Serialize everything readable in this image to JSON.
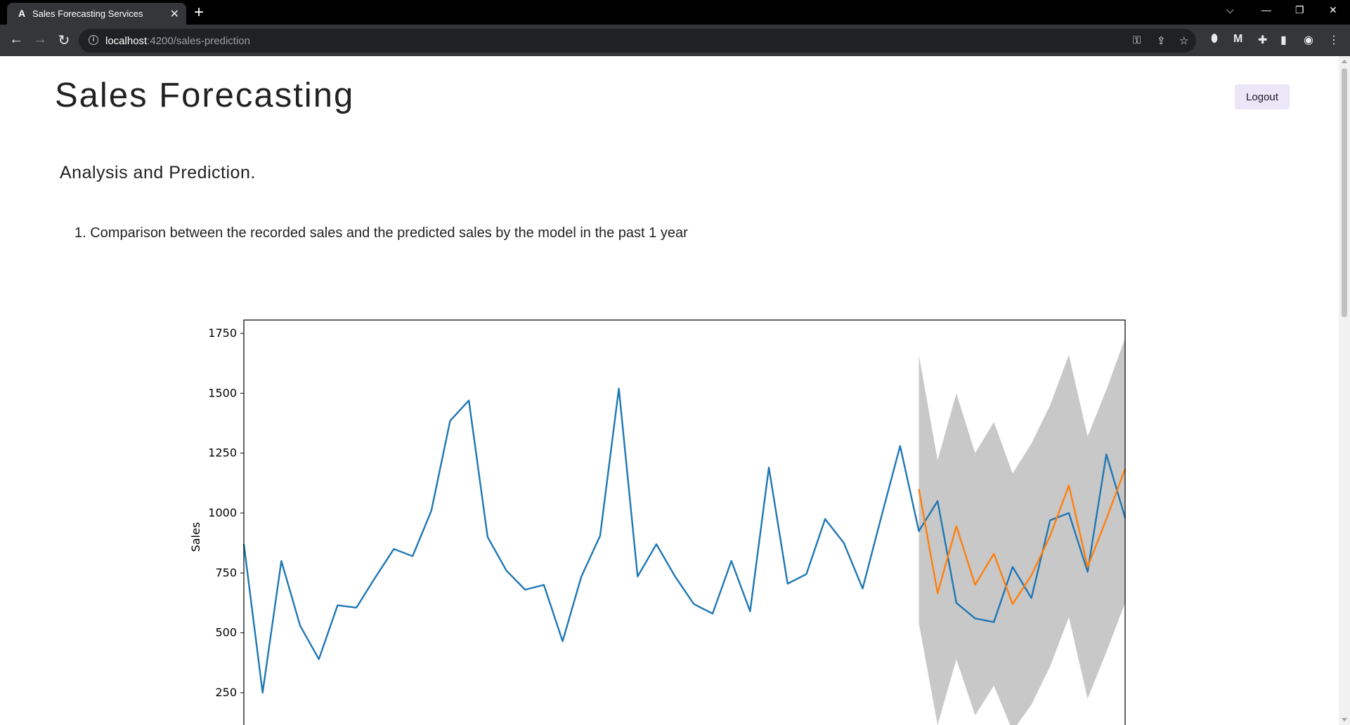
{
  "browser": {
    "tab_title": "Sales Forecasting Services",
    "favicon_letter": "A",
    "url_host": "localhost",
    "url_path": ":4200/sales-prediction"
  },
  "header": {
    "title": "Sales Forecasting",
    "logout_label": "Logout"
  },
  "main": {
    "section_title": "Analysis and Prediction.",
    "list_item": "1. Comparison between the recorded sales and the predicted sales by the model in the past 1 year"
  },
  "chart_data": {
    "type": "line",
    "ylabel": "Sales",
    "ylim": [
      100,
      1830
    ],
    "yticks": [
      250,
      500,
      750,
      1000,
      1250,
      1500,
      1750
    ],
    "x_count": 47,
    "colors": {
      "recorded": "#1f77b4",
      "predicted": "#ff7f0e",
      "interval": "#c8c8c8"
    },
    "series": [
      {
        "values": [
          870,
          250,
          800,
          530,
          390,
          615,
          605,
          730,
          850,
          820,
          1010,
          1385,
          1470,
          900,
          760,
          680,
          700,
          465,
          735,
          905,
          1520,
          735,
          870,
          735,
          620,
          580,
          800,
          590,
          1190,
          705,
          745,
          975,
          875,
          685,
          985,
          1280,
          925,
          1050,
          625,
          560,
          545,
          775,
          645,
          970,
          1000,
          755,
          1245,
          980
        ]
      },
      {
        "start_index": 36,
        "values": [
          1100,
          665,
          945,
          700,
          830,
          620,
          740,
          905,
          1115,
          775,
          975,
          1185
        ]
      }
    ],
    "interval": {
      "start_index": 36,
      "upper": [
        1660,
        1220,
        1500,
        1250,
        1380,
        1165,
        1290,
        1450,
        1660,
        1320,
        1515,
        1730
      ],
      "lower": [
        540,
        115,
        390,
        155,
        280,
        90,
        200,
        360,
        565,
        225,
        420,
        625
      ]
    }
  }
}
